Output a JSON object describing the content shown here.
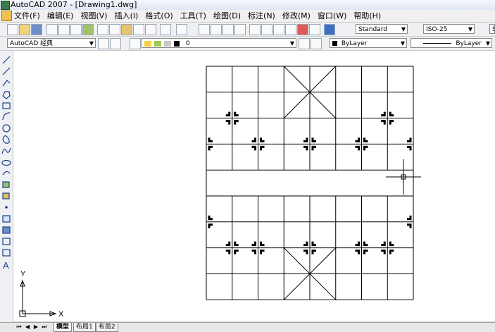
{
  "window": {
    "title": "AutoCAD 2007 - [Drawing1.dwg]"
  },
  "menu": [
    "文件(F)",
    "编辑(E)",
    "视图(V)",
    "插入(I)",
    "格式(O)",
    "工具(T)",
    "绘图(D)",
    "标注(N)",
    "修改(M)",
    "窗口(W)",
    "帮助(H)"
  ],
  "toolbar1": {
    "text_style": "Standard",
    "dim_style": "ISO-25",
    "table_style_partial": "S"
  },
  "toolbar2": {
    "workspace": "AutoCAD 经典",
    "layer": "0",
    "color": "ByLayer",
    "linetype": "ByLayer"
  },
  "ucs": {
    "x_label": "X",
    "y_label": "Y"
  },
  "tabs": [
    "模型",
    "布局1",
    "布局2"
  ]
}
